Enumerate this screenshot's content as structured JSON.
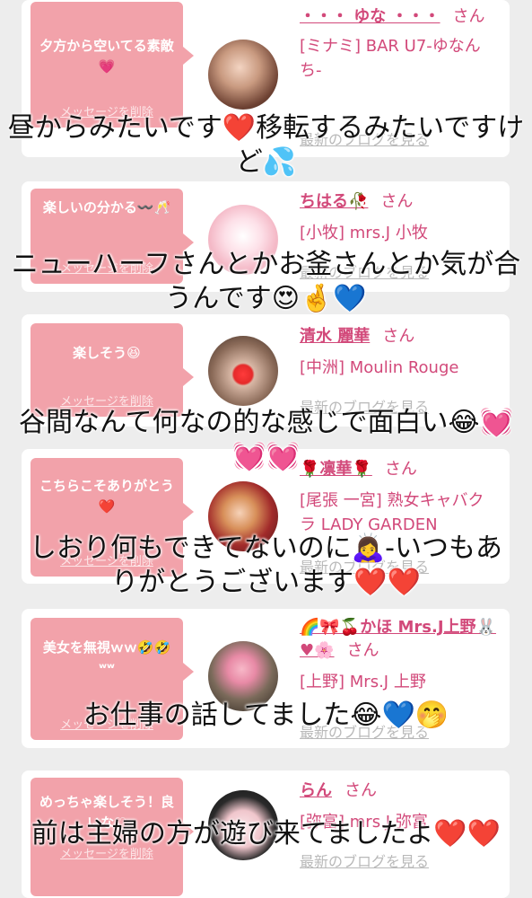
{
  "delete_label": "メッセージを削除",
  "blog_label": "最新のブログを見る",
  "cards": [
    {
      "message": "夕方から空いてる素敵💗",
      "name": "・・・ ゆな ・・・",
      "honorific": "さん",
      "shop": "[ミナミ] BAR U7-ゆなんち-"
    },
    {
      "message": "楽しいの分かる〰️🥂",
      "name": "ちはる🥀",
      "honorific": "さん",
      "shop": "[小牧] mrs.J 小牧"
    },
    {
      "message": "楽しそう😆",
      "name": "清水 麗華",
      "honorific": "さん",
      "shop": "[中洲] Moulin Rouge"
    },
    {
      "message": "こちらこそありがとう❤️",
      "name": "🌹凛華🌹",
      "honorific": "さん",
      "shop": "[尾張 一宮] 熟女キャバクラ LADY GARDEN"
    },
    {
      "message": "美女を無視ｗｗ🤣🤣ʷʷ",
      "name": "🌈🎀🍒かほ Mrs.J上野🐰♥🌸",
      "honorific": "さん",
      "shop": "[上野] Mrs.J 上野"
    },
    {
      "message": "めっちゃ楽しそう！良いな♡",
      "name": "らん",
      "honorific": "さん",
      "shop": "[弥富] mrs.J 弥富"
    }
  ],
  "captions": [
    "昼からみたいです❤️移転するみたいですけど💦",
    "ニューハーフさんとかお釜さんとか気が合うんです😍🤞💙",
    "谷間なんて何なの的な感じで面白い😂💓💓💓",
    "しおり何もできてないのに🙇‍♀️-いつもありがとうございます❤️❤️",
    "お仕事の話してました😂💙🤭",
    "前は主婦の方が遊び来てましたよ❤️❤️"
  ],
  "colors": {
    "pink_bubble": "#f2a2aa",
    "name_pink": "#d2497a",
    "background": "#ededed"
  }
}
